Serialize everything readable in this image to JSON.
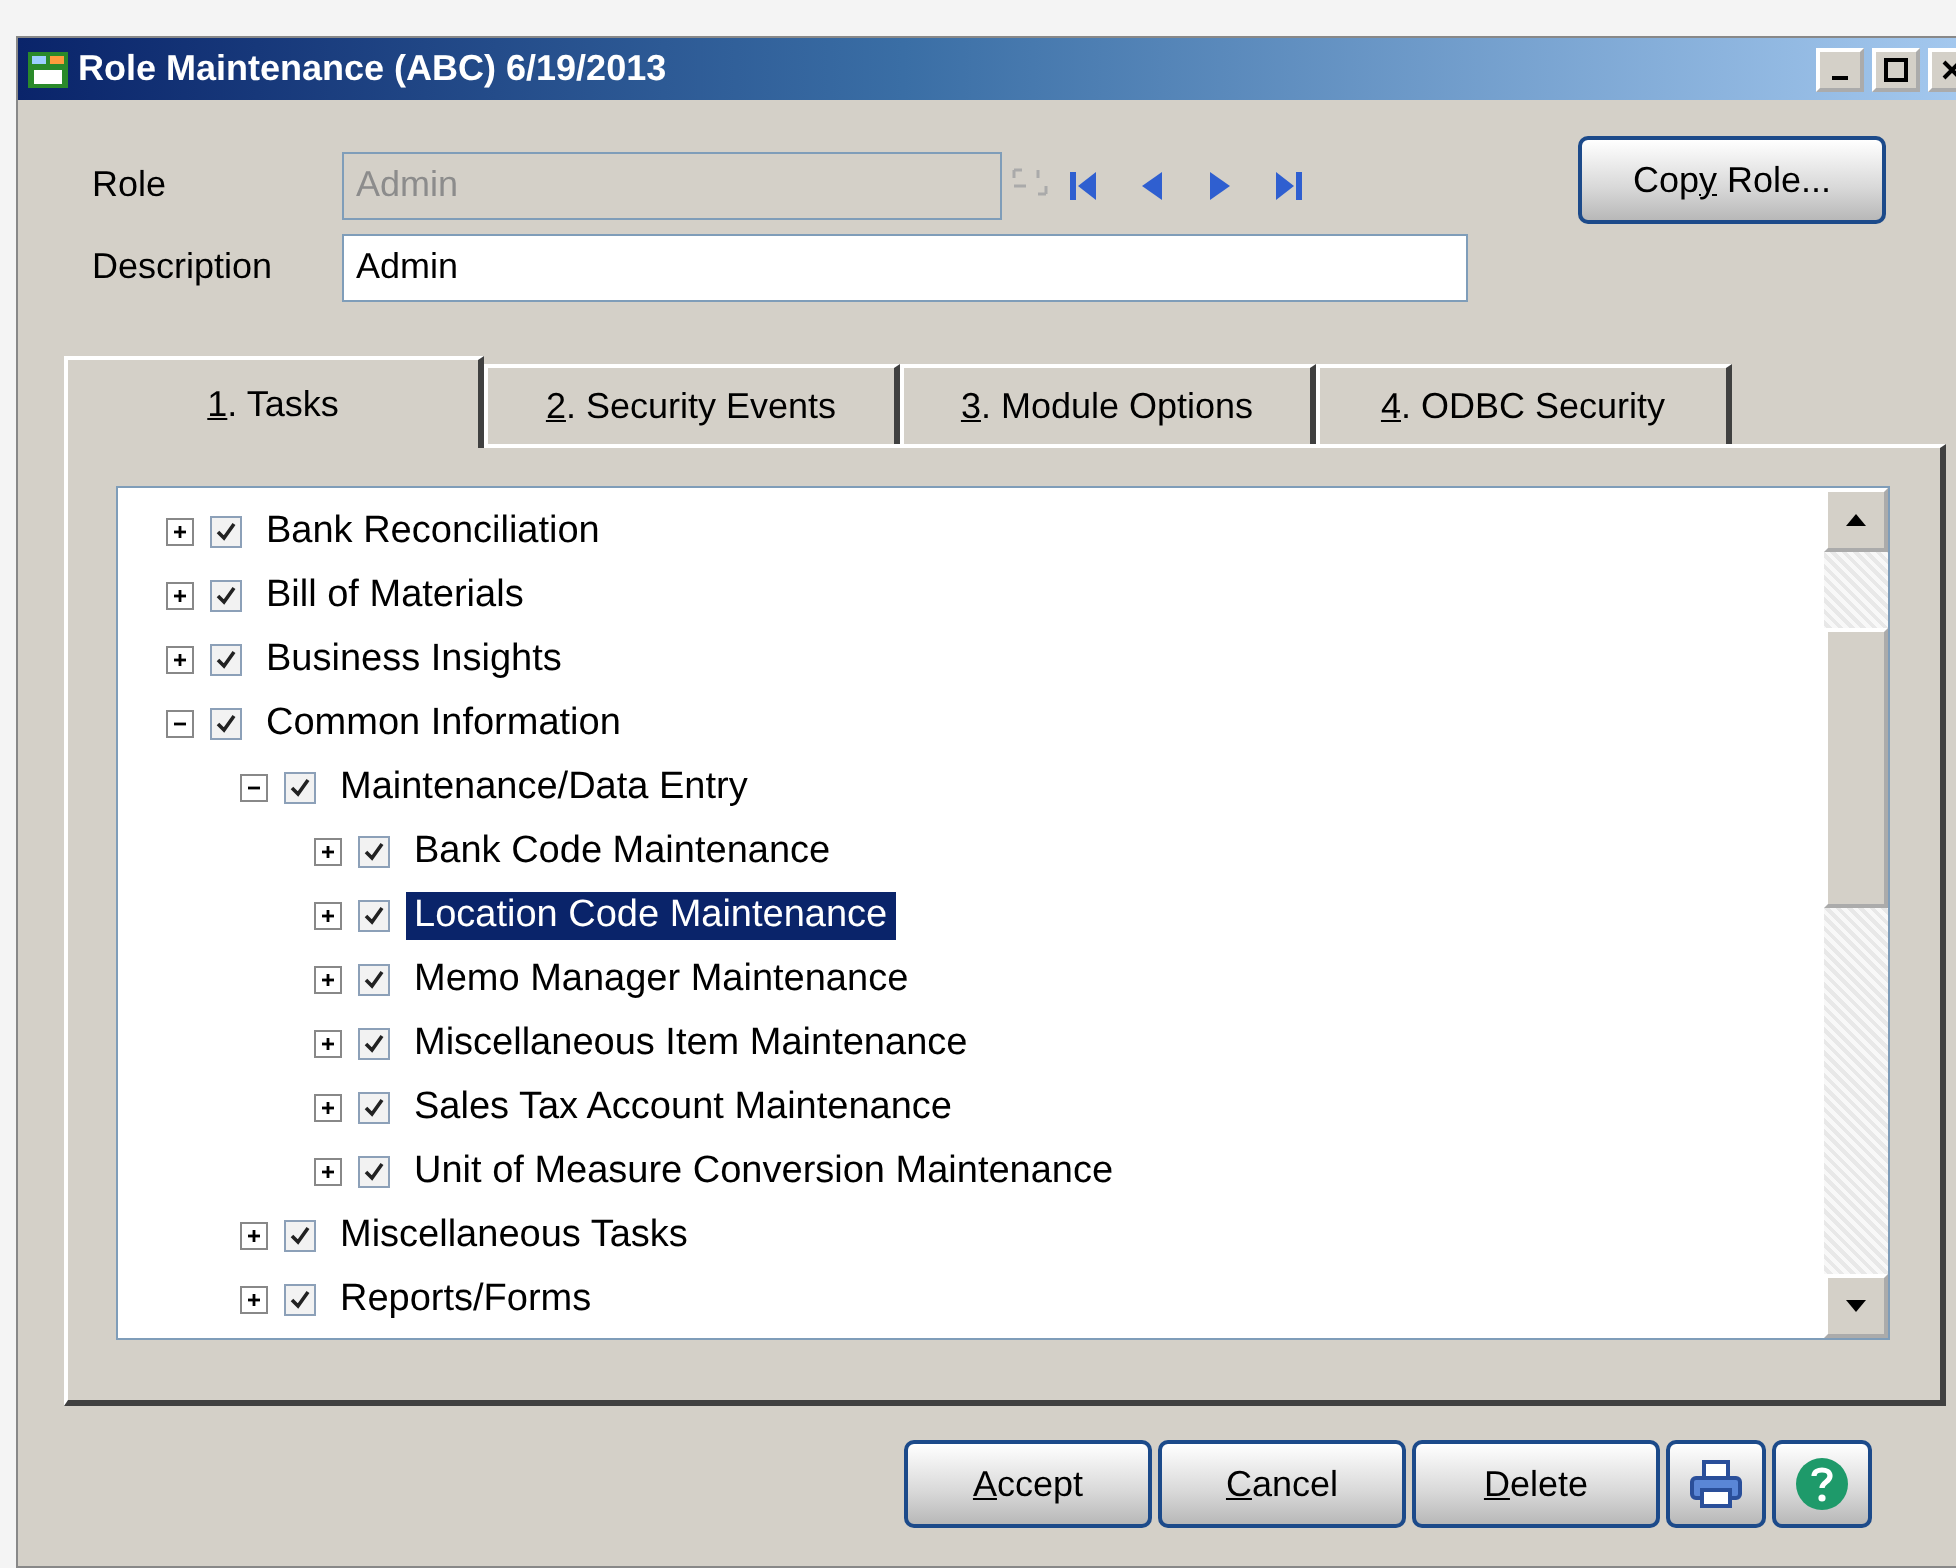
{
  "window": {
    "title": "Role Maintenance (ABC) 6/19/2013"
  },
  "role": {
    "label": "Role",
    "value": "Admin",
    "disabled": true
  },
  "description": {
    "label": "Description",
    "value": "Admin"
  },
  "copy_button": {
    "before": "Cop",
    "key": "y",
    "after": " Role..."
  },
  "tabs": [
    {
      "key": "1",
      "after": ". Tasks",
      "selected": true
    },
    {
      "key": "2",
      "after": ". Security Events",
      "selected": false
    },
    {
      "key": "3",
      "after": ". Module Options",
      "selected": false
    },
    {
      "key": "4",
      "after": ". ODBC Security",
      "selected": false
    }
  ],
  "tree": [
    {
      "label": "Bank Reconciliation",
      "checked": true,
      "expanded": false,
      "selected": false
    },
    {
      "label": "Bill of Materials",
      "checked": true,
      "expanded": false,
      "selected": false
    },
    {
      "label": "Business Insights",
      "checked": true,
      "expanded": false,
      "selected": false
    },
    {
      "label": "Common Information",
      "checked": true,
      "expanded": true,
      "selected": false,
      "children": [
        {
          "label": "Maintenance/Data Entry",
          "checked": true,
          "expanded": true,
          "selected": false,
          "children": [
            {
              "label": "Bank Code Maintenance",
              "checked": true,
              "expanded": false,
              "selected": false
            },
            {
              "label": "Location Code Maintenance",
              "checked": true,
              "expanded": false,
              "selected": true
            },
            {
              "label": "Memo Manager Maintenance",
              "checked": true,
              "expanded": false,
              "selected": false
            },
            {
              "label": "Miscellaneous Item Maintenance",
              "checked": true,
              "expanded": false,
              "selected": false
            },
            {
              "label": "Sales Tax Account Maintenance",
              "checked": true,
              "expanded": false,
              "selected": false
            },
            {
              "label": "Unit of Measure Conversion Maintenance",
              "checked": true,
              "expanded": false,
              "selected": false
            }
          ]
        },
        {
          "label": "Miscellaneous Tasks",
          "checked": true,
          "expanded": false,
          "selected": false
        },
        {
          "label": "Reports/Forms",
          "checked": true,
          "expanded": false,
          "selected": false
        }
      ]
    }
  ],
  "buttons": [
    {
      "key": "A",
      "after": "ccept"
    },
    {
      "key": "C",
      "after": "ancel"
    },
    {
      "key": "D",
      "after": "elete"
    }
  ]
}
